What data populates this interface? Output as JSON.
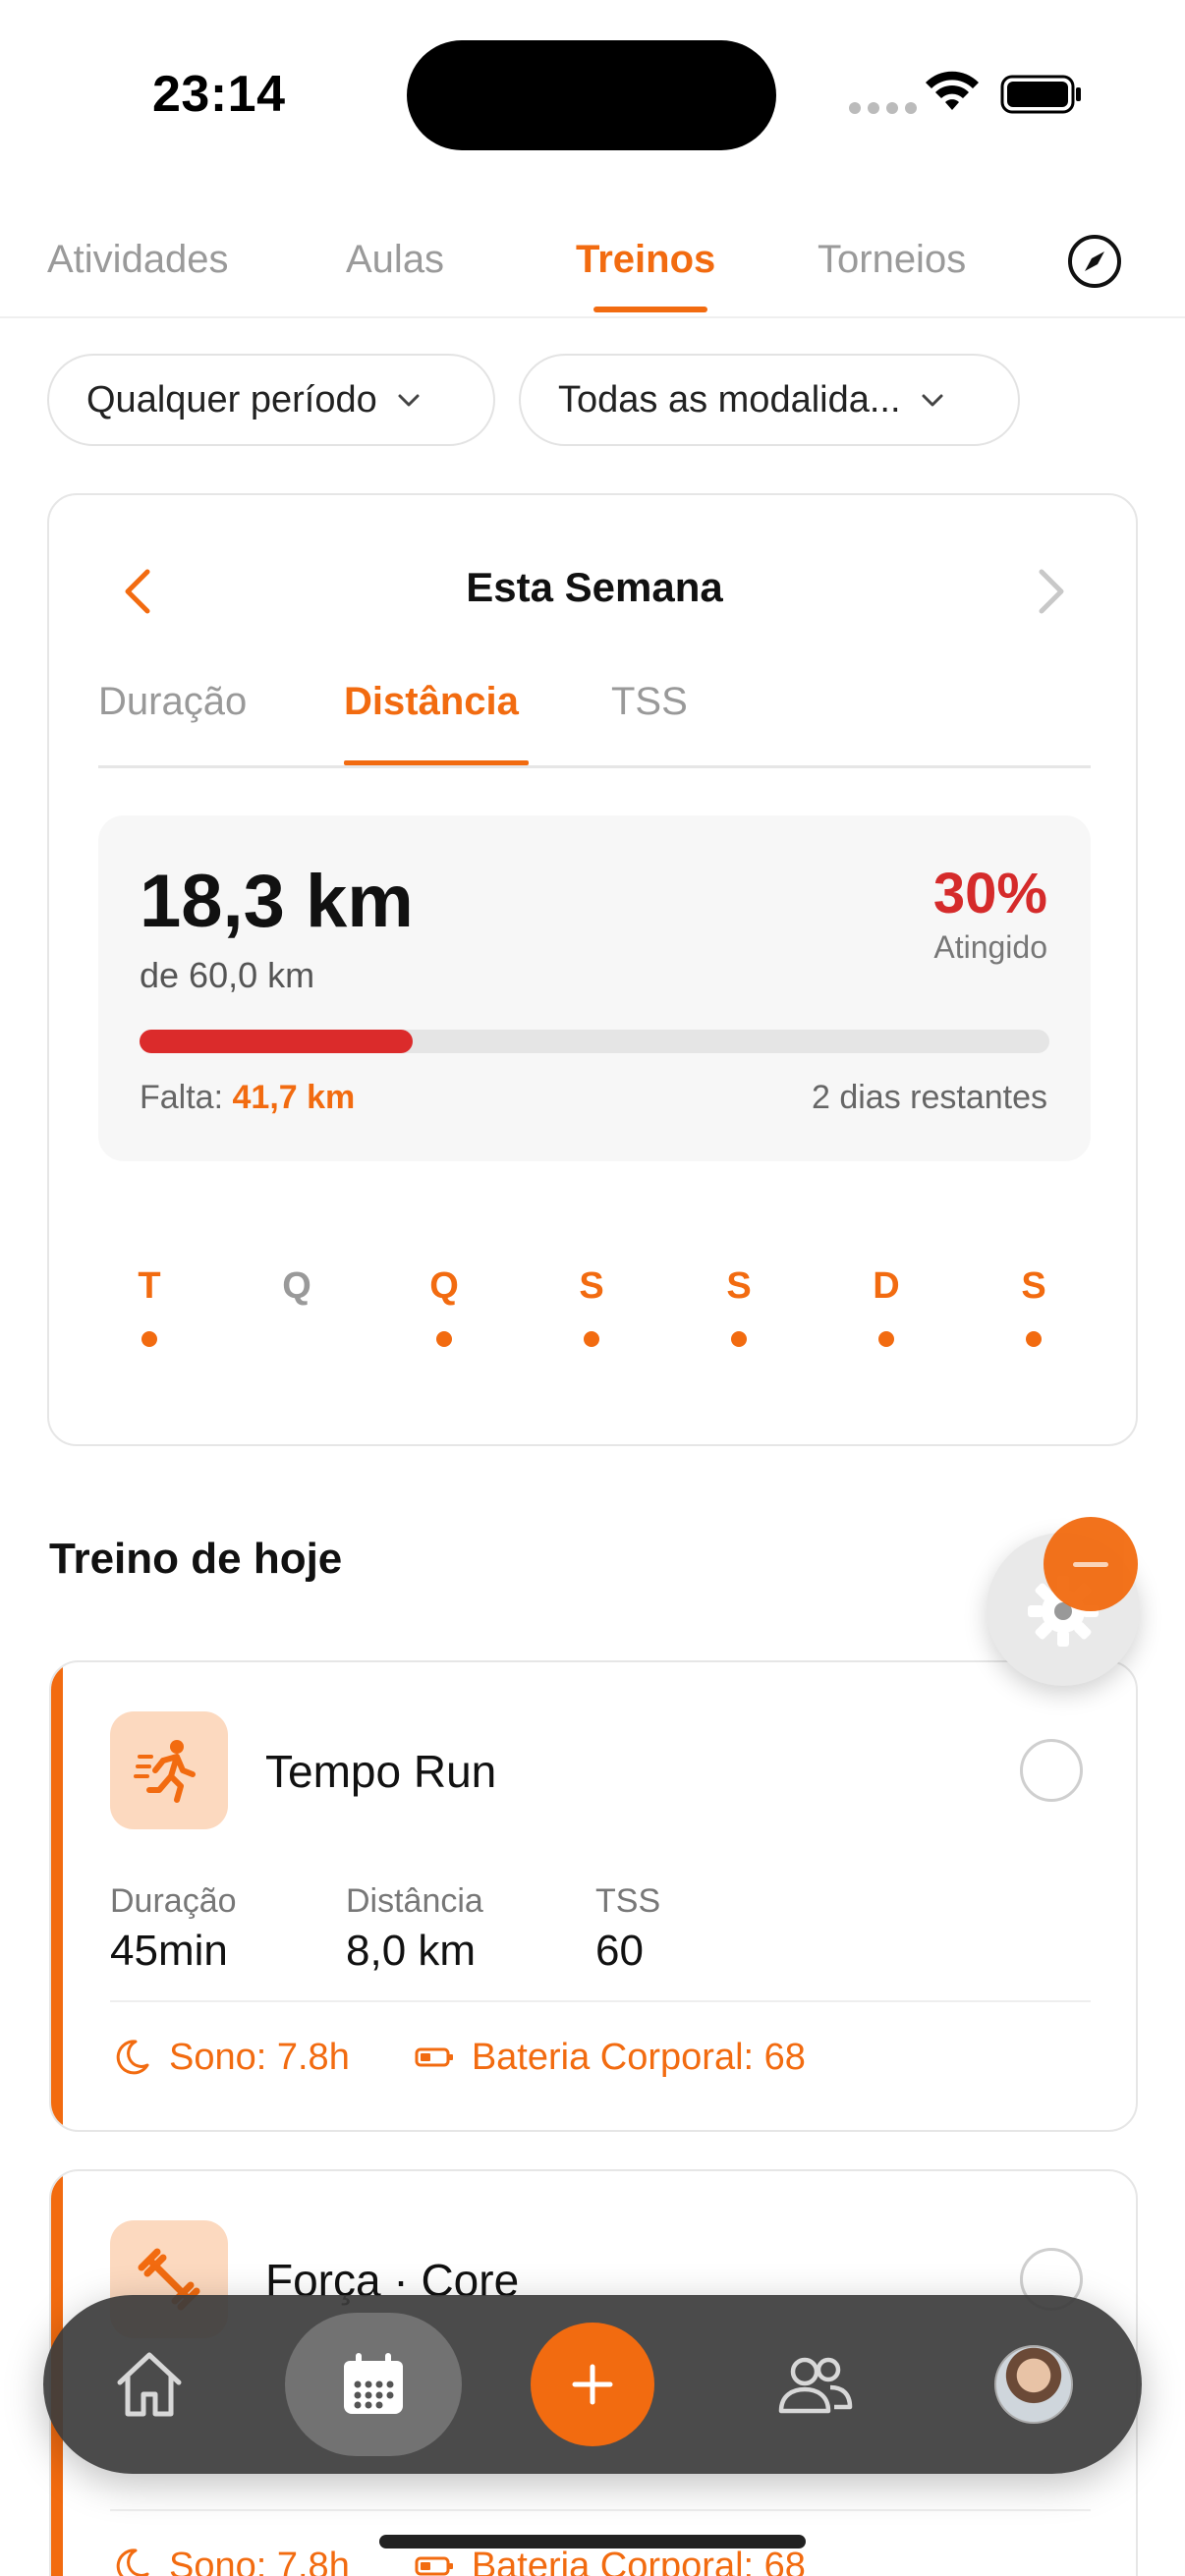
{
  "status_bar": {
    "time": "23:14"
  },
  "top_tabs": [
    {
      "label": "Atividades",
      "active": false
    },
    {
      "label": "Aulas",
      "active": false
    },
    {
      "label": "Treinos",
      "active": true
    },
    {
      "label": "Torneios",
      "active": false
    }
  ],
  "filters": {
    "period": "Qualquer período",
    "modality": "Todas as modalida..."
  },
  "week": {
    "title": "Esta Semana",
    "metric_tabs": [
      "Duração",
      "Distância",
      "TSS"
    ],
    "active_metric": "Distância",
    "distance_value": "18,3 km",
    "distance_target": "de 60,0 km",
    "percent": "30%",
    "percent_label": "Atingido",
    "progress_fraction": 0.3,
    "remaining_label": "Falta:",
    "remaining_value": "41,7 km",
    "days_left": "2 dias restantes",
    "days": [
      {
        "letter": "T",
        "done": true
      },
      {
        "letter": "Q",
        "done": false
      },
      {
        "letter": "Q",
        "done": true
      },
      {
        "letter": "S",
        "done": true
      },
      {
        "letter": "S",
        "done": true
      },
      {
        "letter": "D",
        "done": true
      },
      {
        "letter": "S",
        "done": true
      }
    ]
  },
  "today": {
    "section_title": "Treino de hoje",
    "workouts": [
      {
        "title": "Tempo Run",
        "icon": "running-icon",
        "stats": [
          {
            "label": "Duração",
            "value": "45min"
          },
          {
            "label": "Distância",
            "value": "8,0 km"
          },
          {
            "label": "TSS",
            "value": "60"
          }
        ],
        "sleep": "Sono: 7.8h",
        "body_battery": "Bateria Corporal: 68"
      },
      {
        "title": "Força · Core",
        "icon": "dumbbell-icon",
        "sleep": "Sono: 7.8h",
        "body_battery": "Bateria Corporal: 68"
      }
    ]
  },
  "colors": {
    "accent": "#f26b10",
    "progress": "#db2b2b",
    "percent": "#d52b2b"
  },
  "bottom_nav": [
    "home-icon",
    "calendar-icon",
    "plus-icon",
    "people-icon",
    "avatar"
  ]
}
